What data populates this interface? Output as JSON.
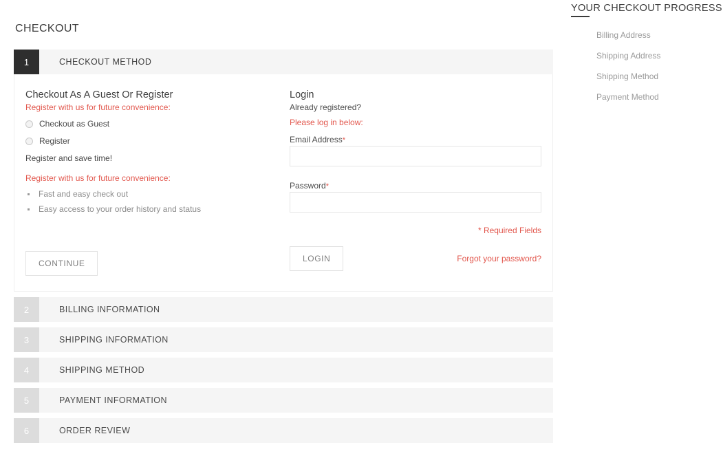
{
  "page": {
    "title": "CHECKOUT"
  },
  "checkout_steps": [
    {
      "number": "1",
      "title": "CHECKOUT METHOD",
      "state": "active"
    },
    {
      "number": "2",
      "title": "BILLING INFORMATION",
      "state": "collapsed"
    },
    {
      "number": "3",
      "title": "SHIPPING INFORMATION",
      "state": "collapsed"
    },
    {
      "number": "4",
      "title": "SHIPPING METHOD",
      "state": "collapsed"
    },
    {
      "number": "5",
      "title": "PAYMENT INFORMATION",
      "state": "collapsed"
    },
    {
      "number": "6",
      "title": "ORDER REVIEW",
      "state": "collapsed"
    }
  ],
  "guest_register": {
    "heading": "Checkout As A Guest Or Register",
    "register_note_top": "Register with us for future convenience:",
    "options": [
      {
        "label": "Checkout as Guest",
        "selected": false
      },
      {
        "label": "Register",
        "selected": false
      }
    ],
    "save_time_text": "Register and save time!",
    "register_note_bottom": "Register with us for future convenience:",
    "benefits": [
      "Fast and easy check out",
      "Easy access to your order history and status"
    ],
    "continue_label": "CONTINUE"
  },
  "login": {
    "heading": "Login",
    "already_registered": "Already registered?",
    "please_login": "Please log in below:",
    "email_label": "Email Address",
    "email_value": "",
    "email_placeholder": "",
    "password_label": "Password",
    "password_value": "",
    "password_placeholder": "",
    "required_marker": "*",
    "required_fields_note": "* Required Fields",
    "forgot_password_label": "Forgot your password?",
    "login_label": "LOGIN"
  },
  "sidebar": {
    "title": "YOUR CHECKOUT PROGRESS",
    "items": [
      {
        "label": "Billing Address"
      },
      {
        "label": "Shipping Address"
      },
      {
        "label": "Shipping Method"
      },
      {
        "label": "Payment Method"
      }
    ]
  },
  "colors": {
    "accent_red": "#e2574d",
    "active_step_bg": "#2e2e2e",
    "inactive_step_bg": "#dcdcdc",
    "header_bar_bg": "#f5f5f5",
    "text_primary": "#3f3f3f",
    "text_muted": "#9a9a9a"
  }
}
